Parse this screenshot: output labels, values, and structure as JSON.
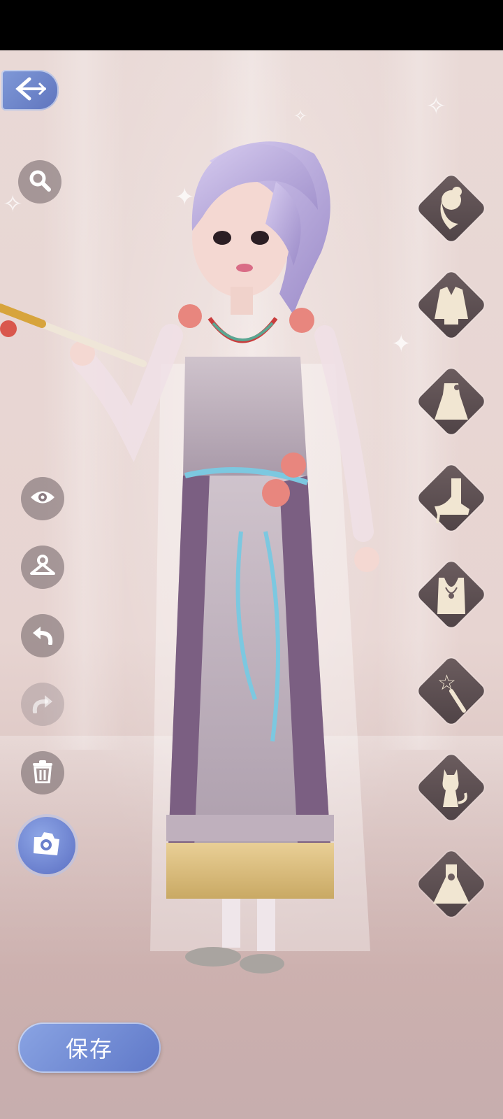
{
  "status_bar": {},
  "toolbar": {
    "back_icon": "back-arrow-icon",
    "left_tools": [
      {
        "name": "search-icon"
      },
      {
        "name": "eye-icon"
      },
      {
        "name": "hanger-icon"
      },
      {
        "name": "undo-icon"
      },
      {
        "name": "redo-icon"
      },
      {
        "name": "trash-icon"
      },
      {
        "name": "camera-icon"
      }
    ]
  },
  "categories": [
    {
      "name": "hairstyle"
    },
    {
      "name": "jacket"
    },
    {
      "name": "dress-top"
    },
    {
      "name": "shoes"
    },
    {
      "name": "necklace"
    },
    {
      "name": "magic-wand"
    },
    {
      "name": "pet-cat"
    },
    {
      "name": "gown"
    }
  ],
  "save_button": {
    "label": "保存"
  },
  "colors": {
    "accent_blue": "#6f86cf",
    "tab_dark": "#5a4c4f",
    "background": "#e7d4d1"
  }
}
